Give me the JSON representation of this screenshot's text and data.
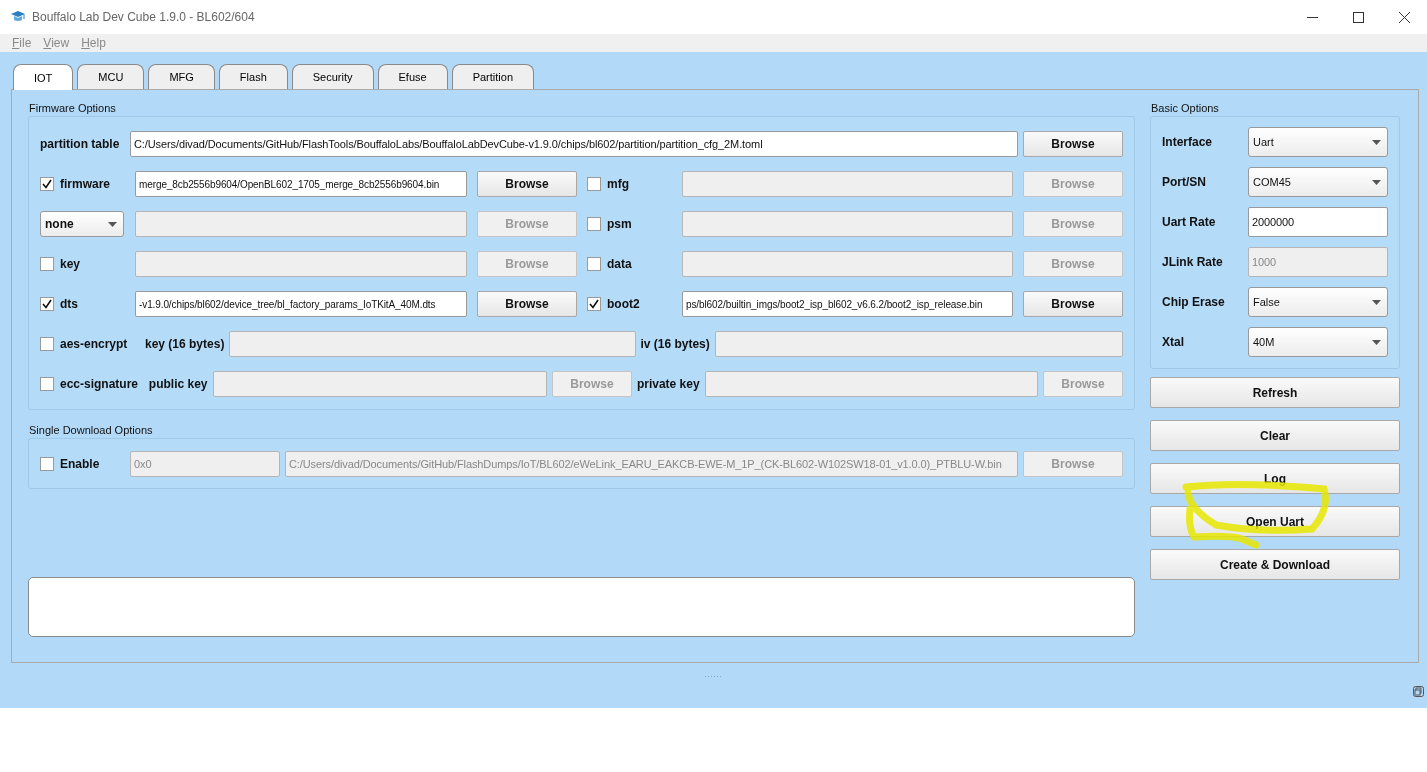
{
  "window": {
    "title": "Bouffalo Lab Dev Cube 1.9.0 - BL602/604"
  },
  "menu": [
    "File",
    "View",
    "Help"
  ],
  "tabs": [
    {
      "label": "IOT",
      "selected": true
    },
    {
      "label": "MCU",
      "selected": false
    },
    {
      "label": "MFG",
      "selected": false
    },
    {
      "label": "Flash",
      "selected": false
    },
    {
      "label": "Security",
      "selected": false
    },
    {
      "label": "Efuse",
      "selected": false
    },
    {
      "label": "Partition",
      "selected": false
    }
  ],
  "firmware_options": {
    "title": "Firmware Options",
    "partition_table": {
      "label": "partition table",
      "path": "C:/Users/divad/Documents/GitHub/FlashTools/BouffaloLabs/BouffaloLabDevCube-v1.9.0/chips/bl602/partition/partition_cfg_2M.toml",
      "browse": "Browse"
    },
    "items": [
      {
        "kind": "checkbox",
        "label": "firmware",
        "checked": true,
        "disabled": false,
        "path": "merge_8cb2556b9604/OpenBL602_1705_merge_8cb2556b9604.bin",
        "browse": "Browse"
      },
      {
        "kind": "checkbox",
        "label": "mfg",
        "checked": false,
        "disabled": true,
        "browse": "Browse"
      },
      {
        "kind": "select",
        "value": "none",
        "disabled": true,
        "browse": "Browse"
      },
      {
        "kind": "checkbox",
        "label": "psm",
        "checked": false,
        "disabled": true,
        "browse": "Browse"
      },
      {
        "kind": "checkbox",
        "label": "key",
        "checked": false,
        "disabled": true,
        "browse": "Browse"
      },
      {
        "kind": "checkbox",
        "label": "data",
        "checked": false,
        "disabled": true,
        "browse": "Browse"
      },
      {
        "kind": "checkbox",
        "label": "dts",
        "checked": true,
        "disabled": false,
        "path": "-v1.9.0/chips/bl602/device_tree/bl_factory_params_IoTKitA_40M.dts",
        "browse": "Browse"
      },
      {
        "kind": "checkbox",
        "label": "boot2",
        "checked": true,
        "disabled": false,
        "path": "ps/bl602/builtin_imgs/boot2_isp_bl602_v6.6.2/boot2_isp_release.bin",
        "browse": "Browse"
      }
    ],
    "aes": {
      "label": "aes-encrypt",
      "checked": false,
      "disabled": true,
      "key_label": "key (16 bytes)",
      "iv_label": "iv (16 bytes)"
    },
    "ecc": {
      "label": "ecc-signature",
      "checked": false,
      "disabled": true,
      "public_key_label": "public key",
      "public_browse": "Browse",
      "private_key_label": "private key",
      "private_browse": "Browse"
    }
  },
  "single_download": {
    "title": "Single Download Options",
    "label": "Enable",
    "checked": false,
    "disabled": true,
    "address": "0x0",
    "path": "C:/Users/divad/Documents/GitHub/FlashDumps/IoT/BL602/eWeLink_EARU_EAKCB-EWE-M_1P_(CK-BL602-W102SW18-01_v1.0.0)_PTBLU-W.bin",
    "browse": "Browse"
  },
  "basic_options": {
    "title": "Basic Options",
    "rows": [
      {
        "label": "Interface",
        "kind": "select",
        "value": "Uart",
        "disabled": false
      },
      {
        "label": "Port/SN",
        "kind": "select",
        "value": "COM45",
        "disabled": false
      },
      {
        "label": "Uart Rate",
        "kind": "input",
        "value": "2000000",
        "disabled": false
      },
      {
        "label": "JLink Rate",
        "kind": "input",
        "value": "1000",
        "disabled": true
      },
      {
        "label": "Chip Erase",
        "kind": "select",
        "value": "False",
        "disabled": false
      },
      {
        "label": "Xtal",
        "kind": "select",
        "value": "40M",
        "disabled": false
      }
    ]
  },
  "actions": [
    "Refresh",
    "Clear",
    "Log",
    "Open Uart",
    "Create & Download"
  ]
}
